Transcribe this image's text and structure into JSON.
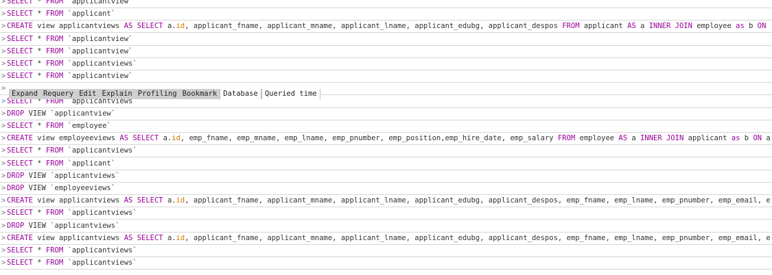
{
  "rows": [
    {
      "prompt": ">",
      "parts": [
        {
          "k": "kw",
          "t": "SELECT"
        },
        {
          "k": "txt",
          "t": " * "
        },
        {
          "k": "kw",
          "t": "FROM"
        },
        {
          "k": "txt",
          "t": " `applicantview`"
        }
      ]
    },
    {
      "prompt": ">",
      "parts": [
        {
          "k": "kw",
          "t": "SELECT"
        },
        {
          "k": "txt",
          "t": " * "
        },
        {
          "k": "kw",
          "t": "FROM"
        },
        {
          "k": "txt",
          "t": " `applicant`"
        }
      ]
    },
    {
      "prompt": ">",
      "parts": [
        {
          "k": "kw",
          "t": "CREATE"
        },
        {
          "k": "txt",
          "t": " view applicantviews "
        },
        {
          "k": "kw",
          "t": "AS"
        },
        {
          "k": "txt",
          "t": " "
        },
        {
          "k": "kw",
          "t": "SELECT"
        },
        {
          "k": "txt",
          "t": " a."
        },
        {
          "k": "fn",
          "t": "id"
        },
        {
          "k": "txt",
          "t": ", applicant_fname, applicant_mname, applicant_lname, applicant_edubg, applicant_despos "
        },
        {
          "k": "kw",
          "t": "FROM"
        },
        {
          "k": "txt",
          "t": " applicant "
        },
        {
          "k": "kw",
          "t": "AS"
        },
        {
          "k": "txt",
          "t": " a "
        },
        {
          "k": "kw",
          "t": "INNER JOIN"
        },
        {
          "k": "txt",
          "t": " employee "
        },
        {
          "k": "kw",
          "t": "as"
        },
        {
          "k": "txt",
          "t": " b "
        },
        {
          "k": "kw",
          "t": "ON"
        },
        {
          "k": "txt",
          "t": " a."
        },
        {
          "k": "ell",
          "t": "i…"
        }
      ]
    },
    {
      "prompt": ">",
      "parts": [
        {
          "k": "kw",
          "t": "SELECT"
        },
        {
          "k": "txt",
          "t": " * "
        },
        {
          "k": "kw",
          "t": "FROM"
        },
        {
          "k": "txt",
          "t": " `applicantview`"
        }
      ]
    },
    {
      "prompt": ">",
      "parts": [
        {
          "k": "kw",
          "t": "SELECT"
        },
        {
          "k": "txt",
          "t": " * "
        },
        {
          "k": "kw",
          "t": "FROM"
        },
        {
          "k": "txt",
          "t": " `applicantview`"
        }
      ]
    },
    {
      "prompt": ">",
      "parts": [
        {
          "k": "kw",
          "t": "SELECT"
        },
        {
          "k": "txt",
          "t": " * "
        },
        {
          "k": "kw",
          "t": "FROM"
        },
        {
          "k": "txt",
          "t": " `applicantviews`"
        }
      ]
    },
    {
      "prompt": ">",
      "parts": [
        {
          "k": "kw",
          "t": "SELECT"
        },
        {
          "k": "txt",
          "t": " * "
        },
        {
          "k": "kw",
          "t": "FROM"
        },
        {
          "k": "txt",
          "t": " `applicantview`"
        }
      ]
    },
    {
      "prompt": ">",
      "parts": []
    },
    {
      "prompt": ">",
      "blue": true,
      "parts": [
        {
          "k": "kw",
          "t": "SELECT"
        },
        {
          "k": "txt",
          "t": " * "
        },
        {
          "k": "kw",
          "t": "FROM"
        },
        {
          "k": "txt",
          "t": " `applicantviews`"
        }
      ]
    },
    {
      "prompt": ">",
      "parts": [
        {
          "k": "kw",
          "t": "DROP"
        },
        {
          "k": "txt",
          "t": " VIEW `applicantview`"
        }
      ]
    },
    {
      "prompt": ">",
      "parts": [
        {
          "k": "kw",
          "t": "SELECT"
        },
        {
          "k": "txt",
          "t": " * "
        },
        {
          "k": "kw",
          "t": "FROM"
        },
        {
          "k": "txt",
          "t": " `employee`"
        }
      ]
    },
    {
      "prompt": ">",
      "parts": [
        {
          "k": "kw",
          "t": "CREATE"
        },
        {
          "k": "txt",
          "t": " view employeeviews "
        },
        {
          "k": "kw",
          "t": "AS"
        },
        {
          "k": "txt",
          "t": " "
        },
        {
          "k": "kw",
          "t": "SELECT"
        },
        {
          "k": "txt",
          "t": " a."
        },
        {
          "k": "fn",
          "t": "id"
        },
        {
          "k": "txt",
          "t": ", emp_fname, emp_mname, emp_lname, emp_pnumber, emp_position,emp_hire_date, emp_salary "
        },
        {
          "k": "kw",
          "t": "FROM"
        },
        {
          "k": "txt",
          "t": " employee "
        },
        {
          "k": "kw",
          "t": "AS"
        },
        {
          "k": "txt",
          "t": " a "
        },
        {
          "k": "kw",
          "t": "INNER JOIN"
        },
        {
          "k": "txt",
          "t": " applicant "
        },
        {
          "k": "kw",
          "t": "as"
        },
        {
          "k": "txt",
          "t": " b "
        },
        {
          "k": "kw",
          "t": "ON"
        },
        {
          "k": "txt",
          "t": " a."
        },
        {
          "k": "ell",
          "t": "id…"
        }
      ]
    },
    {
      "prompt": ">",
      "parts": [
        {
          "k": "kw",
          "t": "SELECT"
        },
        {
          "k": "txt",
          "t": " * "
        },
        {
          "k": "kw",
          "t": "FROM"
        },
        {
          "k": "txt",
          "t": " `applicantviews`"
        }
      ]
    },
    {
      "prompt": ">",
      "parts": [
        {
          "k": "kw",
          "t": "SELECT"
        },
        {
          "k": "txt",
          "t": " * "
        },
        {
          "k": "kw",
          "t": "FROM"
        },
        {
          "k": "txt",
          "t": " `applicant`"
        }
      ]
    },
    {
      "prompt": ">",
      "parts": [
        {
          "k": "kw",
          "t": "DROP"
        },
        {
          "k": "txt",
          "t": " VIEW `applicantviews`"
        }
      ]
    },
    {
      "prompt": ">",
      "parts": [
        {
          "k": "kw",
          "t": "DROP"
        },
        {
          "k": "txt",
          "t": " VIEW `employeeviews`"
        }
      ]
    },
    {
      "prompt": ">",
      "parts": [
        {
          "k": "kw",
          "t": "CREATE"
        },
        {
          "k": "txt",
          "t": " view applicantviews "
        },
        {
          "k": "kw",
          "t": "AS"
        },
        {
          "k": "txt",
          "t": " "
        },
        {
          "k": "kw",
          "t": "SELECT"
        },
        {
          "k": "txt",
          "t": " a."
        },
        {
          "k": "fn",
          "t": "id"
        },
        {
          "k": "txt",
          "t": ", applicant_fname, applicant_mname, applicant_lname, applicant_edubg, applicant_despos, emp_fname, emp_lname, emp_pnumber, emp_email, emp_…"
        }
      ]
    },
    {
      "prompt": ">",
      "parts": [
        {
          "k": "kw",
          "t": "SELECT"
        },
        {
          "k": "txt",
          "t": " * "
        },
        {
          "k": "kw",
          "t": "FROM"
        },
        {
          "k": "txt",
          "t": " `applicantviews`"
        }
      ]
    },
    {
      "prompt": ">",
      "parts": [
        {
          "k": "kw",
          "t": "DROP"
        },
        {
          "k": "txt",
          "t": " VIEW `applicantviews`"
        }
      ]
    },
    {
      "prompt": ">",
      "parts": [
        {
          "k": "kw",
          "t": "CREATE"
        },
        {
          "k": "txt",
          "t": " view applicantviews "
        },
        {
          "k": "kw",
          "t": "AS"
        },
        {
          "k": "txt",
          "t": " "
        },
        {
          "k": "kw",
          "t": "SELECT"
        },
        {
          "k": "txt",
          "t": " a."
        },
        {
          "k": "fn",
          "t": "id"
        },
        {
          "k": "txt",
          "t": ", applicant_fname, applicant_mname, applicant_lname, applicant_edubg, applicant_despos, emp_fname, emp_lname, emp_pnumber, emp_email, emp_…"
        }
      ]
    },
    {
      "prompt": ">",
      "parts": [
        {
          "k": "kw",
          "t": "SELECT"
        },
        {
          "k": "txt",
          "t": " * "
        },
        {
          "k": "kw",
          "t": "FROM"
        },
        {
          "k": "txt",
          "t": " `applicantviews`"
        }
      ]
    },
    {
      "prompt": ">",
      "parts": [
        {
          "k": "kw",
          "t": "SELECT"
        },
        {
          "k": "txt",
          "t": " * "
        },
        {
          "k": "kw",
          "t": "FROM"
        },
        {
          "k": "txt",
          "t": " `applicantviews`"
        }
      ]
    }
  ],
  "context_menu": {
    "expand": "Expand",
    "requery": "Requery",
    "edit": "Edit",
    "explain": "Explain",
    "profiling": "Profiling",
    "bookmark": "Bookmark",
    "database": "Database",
    "queried_time": "Queried time"
  },
  "colors": {
    "keyword": "#990099",
    "identifier_highlight": "#ce7a00",
    "prompt_active": "#4a90d9",
    "row_border": "#d6d6d6",
    "toolbar_button_bg": "#cfcfcf"
  }
}
